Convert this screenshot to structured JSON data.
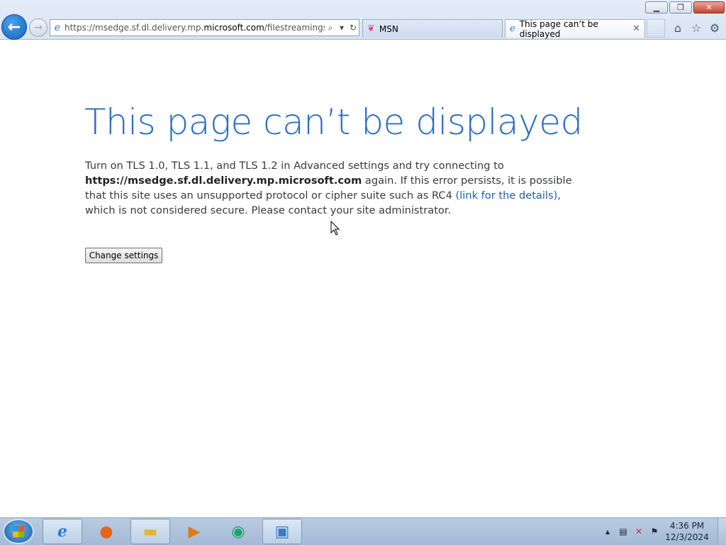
{
  "window": {
    "minimize_icon": "minimize-icon",
    "restore_icon": "restore-icon",
    "close_icon": "close-icon"
  },
  "nav": {
    "url_prefix": "https://msedge.sf.dl.delivery.mp.",
    "url_domain": "microsoft.com",
    "url_suffix": "/filestreamingservic"
  },
  "tabs": [
    {
      "label": "MSN"
    },
    {
      "label": "This page can’t be displayed"
    }
  ],
  "page": {
    "title": "This page can’t be displayed",
    "line1": "Turn on TLS 1.0, TLS 1.1, and TLS 1.2 in Advanced settings and try connecting to",
    "host": "https://msedge.sf.dl.delivery.mp.microsoft.com",
    "line2": " again. If this error persists, it is possible that this site uses an unsupported protocol or cipher suite such as RC4 ",
    "link": "(link for the details)",
    "line3": ", which is not considered secure. Please contact your site administrator.",
    "button": "Change settings"
  },
  "taskbar": {
    "time": "4:36 PM",
    "date": "12/3/2024"
  },
  "colors": {
    "heading": "#2c6dc2",
    "link": "#1d5eaa",
    "back_button": "#1461b8"
  }
}
